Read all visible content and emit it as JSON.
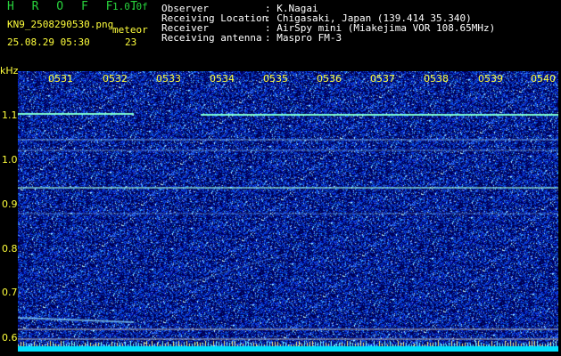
{
  "header": {
    "title": "H R O F F T",
    "version": "1.0.0f",
    "file_name": "KN9_2508290530.png",
    "mode": "meteor",
    "datetime": "25.08.29 05:30",
    "count": "23"
  },
  "info": [
    {
      "key": "Observer",
      "value": ": K.Nagai"
    },
    {
      "key": "Receiving Location",
      "value": ": Chigasaki, Japan (139.414 35.340)"
    },
    {
      "key": "Receiver",
      "value": ": AirSpy mini (Miakejima VOR 108.65MHz)"
    },
    {
      "key": "Receiving antenna",
      "value": ": Maspro FM-3"
    }
  ],
  "spectrogram": {
    "unit": "kHz",
    "y_ticks": [
      "1.1",
      "1.0",
      "0.9",
      "0.8",
      "0.7",
      "0.6"
    ],
    "x_ticks": [
      "0531",
      "0532",
      "0533",
      "0534",
      "0535",
      "0536",
      "0537",
      "0538",
      "0539",
      "0540"
    ],
    "colors": {
      "background": "#000060",
      "noise": "#1e5cff",
      "signal": "#9cffe0",
      "baseline": "#00e0ff"
    }
  }
}
